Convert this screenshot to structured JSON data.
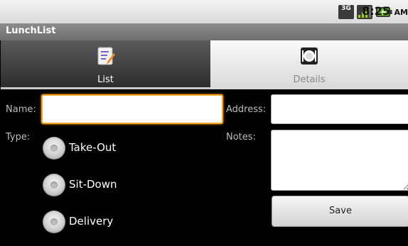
{
  "status_bar": {
    "network": "3G",
    "time": "8:25",
    "ampm": "AM"
  },
  "title": "LunchList",
  "tabs": [
    {
      "label": "List",
      "icon": "list-icon",
      "selected": true
    },
    {
      "label": "Details",
      "icon": "restaurant-icon",
      "selected": false
    }
  ],
  "form": {
    "name_label": "Name:",
    "address_label": "Address:",
    "type_label": "Type:",
    "notes_label": "Notes:",
    "name_value": "",
    "address_value": "",
    "notes_value": "",
    "type_options": [
      "Take-Out",
      "Sit-Down",
      "Delivery"
    ],
    "save_label": "Save"
  },
  "colors": {
    "focus_border": "#f7a020",
    "signal_green": "#9ad014",
    "battery_green": "#5fbf1e"
  }
}
